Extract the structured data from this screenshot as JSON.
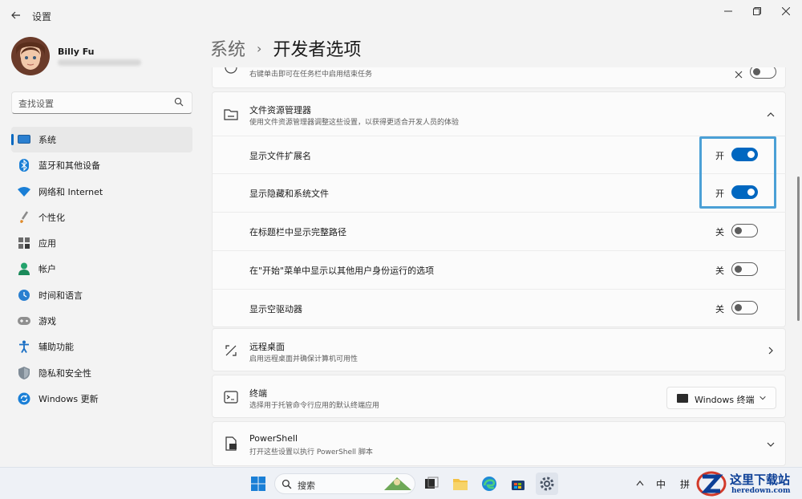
{
  "window": {
    "title": "设置",
    "back_icon": "arrow-left-icon",
    "controls": [
      "minimize-icon",
      "maximize-icon",
      "close-icon"
    ]
  },
  "profile": {
    "name": "Billy Fu"
  },
  "search": {
    "placeholder": "查找设置",
    "icon": "search-icon"
  },
  "sidebar": {
    "items": [
      {
        "label": "系统",
        "icon": "monitor-icon",
        "active": true
      },
      {
        "label": "蓝牙和其他设备",
        "icon": "bluetooth-icon"
      },
      {
        "label": "网络和 Internet",
        "icon": "wifi-icon"
      },
      {
        "label": "个性化",
        "icon": "brush-icon"
      },
      {
        "label": "应用",
        "icon": "apps-icon"
      },
      {
        "label": "帐户",
        "icon": "person-icon"
      },
      {
        "label": "时间和语言",
        "icon": "globe-clock-icon"
      },
      {
        "label": "游戏",
        "icon": "gamepad-icon"
      },
      {
        "label": "辅助功能",
        "icon": "accessibility-icon"
      },
      {
        "label": "隐私和安全性",
        "icon": "shield-icon"
      },
      {
        "label": "Windows 更新",
        "icon": "update-icon"
      }
    ]
  },
  "breadcrumb": {
    "parent": "系统",
    "separator": "›",
    "current": "开发者选项"
  },
  "partial_card": {
    "subtitle": "右键单击即可在任务栏中启用结束任务"
  },
  "file_explorer": {
    "title": "文件资源管理器",
    "subtitle": "使用文件资源管理器调整这些设置，以获得更适合开发人员的体验",
    "rows": [
      {
        "label": "显示文件扩展名",
        "state": "开",
        "on": true
      },
      {
        "label": "显示隐藏和系统文件",
        "state": "开",
        "on": true
      },
      {
        "label": "在标题栏中显示完整路径",
        "state": "关",
        "on": false
      },
      {
        "label": "在\"开始\"菜单中显示以其他用户身份运行的选项",
        "state": "关",
        "on": false
      },
      {
        "label": "显示空驱动器",
        "state": "关",
        "on": false
      }
    ]
  },
  "remote_desktop": {
    "title": "远程桌面",
    "subtitle": "启用远程桌面并确保计算机可用性"
  },
  "terminal": {
    "title": "终端",
    "subtitle": "选择用于托管命令行应用的默认终端应用",
    "dropdown_value": "Windows 终端"
  },
  "powershell": {
    "title": "PowerShell",
    "subtitle": "打开这些设置以执行 PowerShell 脚本"
  },
  "taskbar": {
    "search_label": "搜索",
    "tray": [
      "中",
      "拼"
    ]
  },
  "watermark": {
    "text": "这里下载站",
    "sub": "heredown.com"
  },
  "colors": {
    "accent": "#0067c0",
    "highlight": "#4ba0d6"
  }
}
